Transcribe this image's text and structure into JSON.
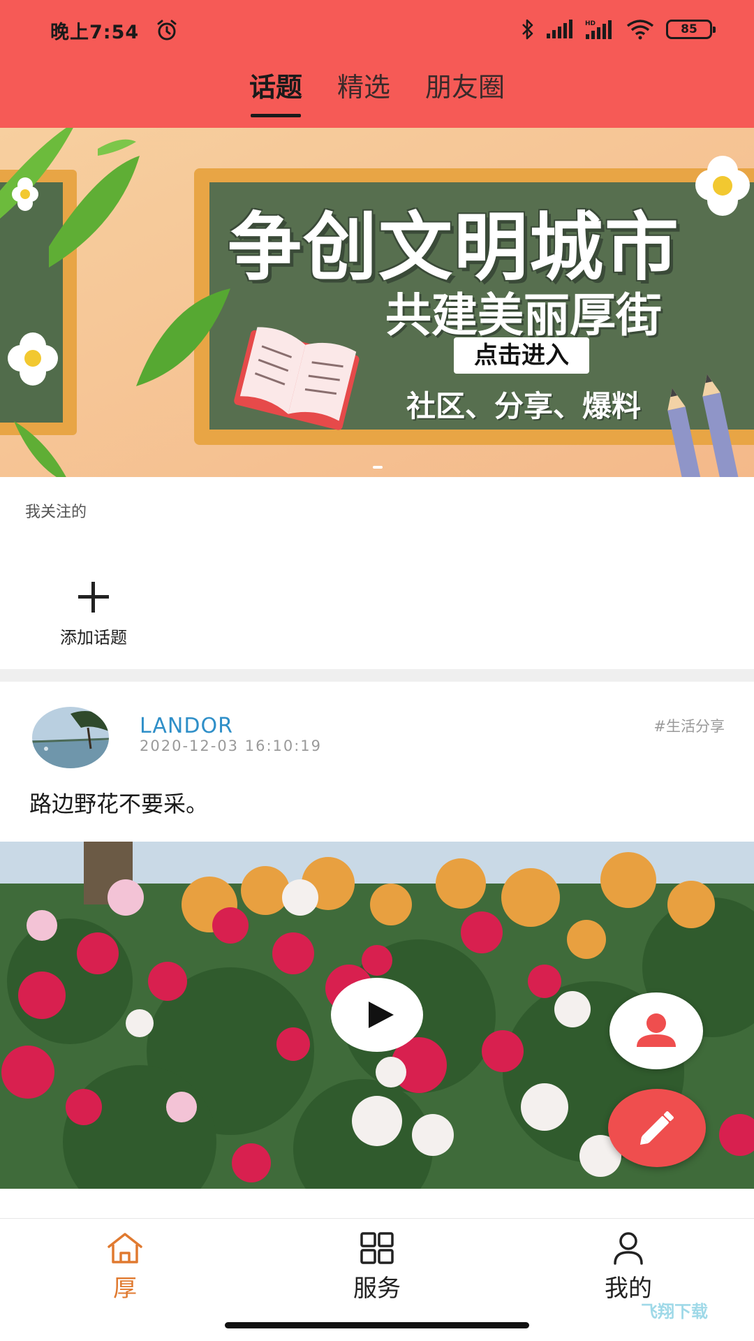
{
  "status": {
    "time": "晚上7:54",
    "battery": "85"
  },
  "tabs": [
    {
      "label": "话题",
      "active": true
    },
    {
      "label": "精选",
      "active": false
    },
    {
      "label": "朋友圈",
      "active": false
    }
  ],
  "banner": {
    "title": "争创文明城市",
    "subtitle": "共建美丽厚街",
    "button": "点击进入",
    "tags": "社区、分享、爆料"
  },
  "following": {
    "title": "我关注的",
    "add_label": "添加话题"
  },
  "post": {
    "user": "LANDOR",
    "time": "2020-12-03  16:10:19",
    "tag": "#生活分享",
    "text": "路边野花不要采。"
  },
  "bottom_nav": [
    {
      "label": "厚",
      "icon": "home-icon",
      "active": true
    },
    {
      "label": "服务",
      "icon": "grid-icon",
      "active": false
    },
    {
      "label": "我的",
      "icon": "person-icon",
      "active": false
    }
  ],
  "watermark": "飞翔下载",
  "colors": {
    "header": "#f65a56",
    "accent": "#e07a30",
    "username": "#2f8fc8",
    "fab_edit": "#ef4e4e"
  }
}
